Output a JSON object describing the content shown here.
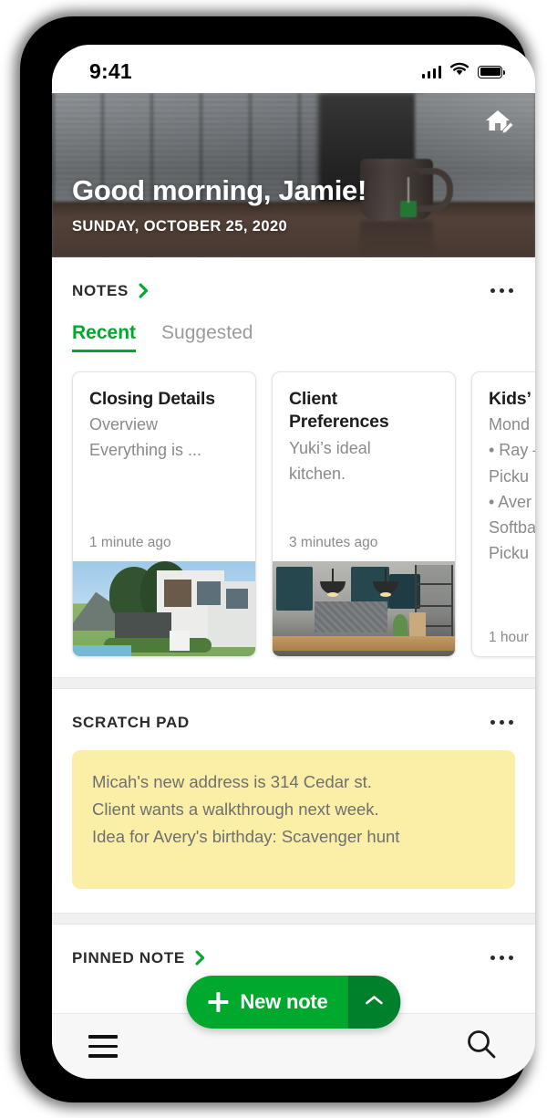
{
  "status_bar": {
    "time": "9:41",
    "cellular_icon": "signal-bars-icon",
    "wifi_icon": "wifi-icon",
    "battery_icon": "battery-full-icon"
  },
  "hero": {
    "greeting": "Good morning, Jamie!",
    "date": "SUNDAY, OCTOBER 25, 2020",
    "customize_icon": "home-edit-icon"
  },
  "notes_section": {
    "title": "NOTES",
    "chevron_icon": "chevron-right-icon",
    "overflow_icon": "more-options-icon",
    "tabs": [
      {
        "label": "Recent",
        "active": true
      },
      {
        "label": "Suggested",
        "active": false
      }
    ],
    "cards": [
      {
        "title": "Closing Details",
        "snippet_line1": "Overview",
        "snippet_line2": "Everything is ...",
        "time": "1 minute ago",
        "thumbnail": "modern-house-photo"
      },
      {
        "title": "Client Preferences",
        "snippet_line1": "Yuki’s ideal",
        "snippet_line2": "kitchen.",
        "time": "3 minutes ago",
        "thumbnail": "kitchen-interior-photo"
      },
      {
        "title": "Kids’",
        "snippet_line1": "Mond",
        "snippet_line2": "• Ray –",
        "snippet_line3": "Picku",
        "snippet_line4": "• Aver",
        "snippet_line5": "Softba",
        "snippet_line6": "Picku",
        "time": "1 hour",
        "thumbnail": "none"
      }
    ]
  },
  "scratch_pad": {
    "title": "SCRATCH PAD",
    "overflow_icon": "more-options-icon",
    "lines": [
      "Micah's new address is 314 Cedar st.",
      "Client wants a walkthrough next week.",
      "Idea for Avery's birthday: Scavenger hunt"
    ]
  },
  "pinned_note": {
    "title": "PINNED NOTE",
    "chevron_icon": "chevron-right-icon",
    "overflow_icon": "more-options-icon"
  },
  "fab": {
    "label": "New note",
    "plus_icon": "plus-icon",
    "caret_icon": "chevron-up-icon"
  },
  "bottom_bar": {
    "menu_icon": "hamburger-menu-icon",
    "search_icon": "search-icon"
  },
  "colors": {
    "accent_green": "#00a82d",
    "accent_green_dark": "#00802a",
    "scratch_yellow": "#fbefa8",
    "band_gray": "#f0f0f0"
  }
}
